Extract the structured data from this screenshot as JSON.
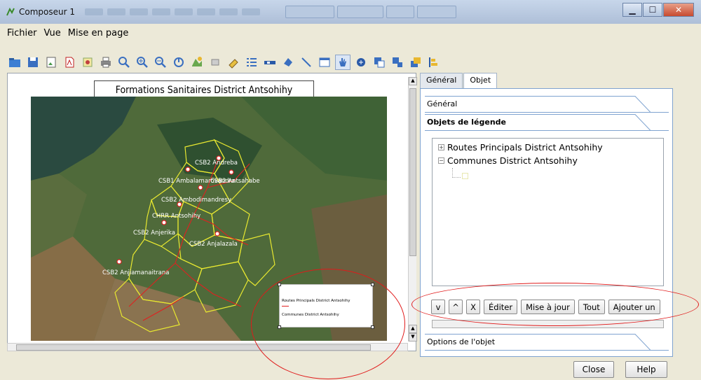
{
  "window": {
    "title": "Composeur 1"
  },
  "menu": [
    "Fichier",
    "Vue",
    "Mise en page"
  ],
  "composition": {
    "title": "Formations Sanitaires District Antsohihy",
    "map_labels": [
      "CSB2 Andreba",
      "CSB1 Ambalamarovandra",
      "CSB2 Antsahabe",
      "CSB2 Ambodimandresy",
      "CHRR Antsohihy",
      "CSB2 Anjerika",
      "CSB2 Anjalazala",
      "CSB2 Anjiamanaitrana"
    ],
    "legend": [
      "Routes Principals District Antsohihy",
      "Communes District Antsohihy"
    ]
  },
  "panel": {
    "tabs": [
      "Général",
      "Objet"
    ],
    "sections": {
      "general": "Général",
      "legend_items": "Objets de légende",
      "item_options": "Options de l'objet"
    },
    "tree": [
      "Routes Principals District Antsohihy",
      "Communes District Antsohihy"
    ],
    "buttons": [
      "v",
      "^",
      "X",
      "Éditer",
      "Mise à jour",
      "Tout",
      "Ajouter un"
    ]
  },
  "footer": {
    "close": "Close",
    "help": "Help"
  },
  "colors": {
    "boundary": "#e8e830",
    "road": "#e02020",
    "annotation": "#e01a1a",
    "panel_border": "#7fa3d0"
  }
}
